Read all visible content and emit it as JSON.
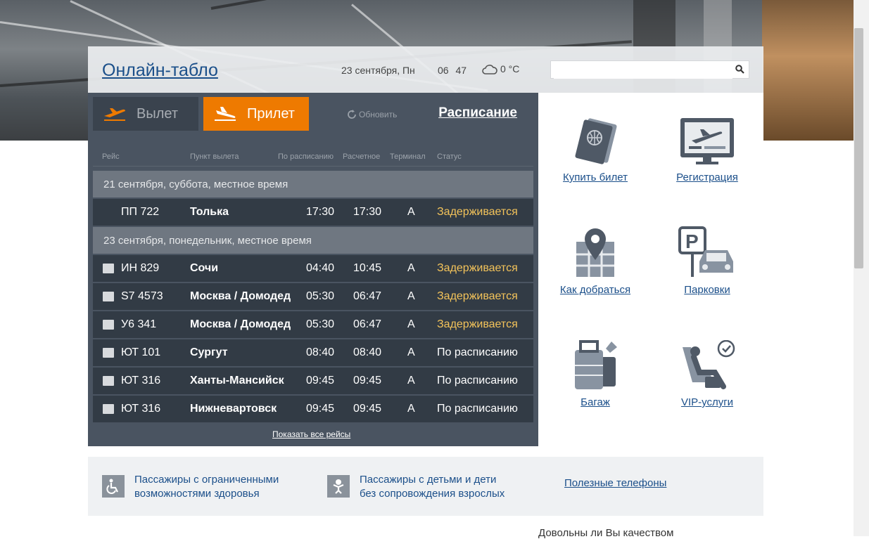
{
  "header": {
    "title": "Онлайн-табло",
    "date": "23 сентября, Пн",
    "time": "06 47",
    "temperature": "0 °C",
    "search_placeholder": ""
  },
  "board": {
    "tabs": {
      "departure": "Вылет",
      "arrival": "Прилет"
    },
    "refresh_label": "Обновить",
    "schedule_link": "Расписание",
    "columns": [
      "Рейс",
      "Пункт вылета",
      "По расписанию",
      "Расчетное",
      "Терминал",
      "Статус"
    ],
    "groups": [
      {
        "date": "21 сентября, суббота, местное время",
        "flights": [
          {
            "flight": "ПП 722",
            "city": "Толька",
            "scheduled": "17:30",
            "estimated": "17:30",
            "terminal": "A",
            "status": "Задерживается",
            "status_type": "delay",
            "logo": ""
          }
        ]
      },
      {
        "date": "23 сентября, понедельник, местное время",
        "flights": [
          {
            "flight": "ИН 829",
            "city": "Сочи",
            "scheduled": "04:40",
            "estimated": "10:45",
            "terminal": "A",
            "status": "Задерживается",
            "status_type": "delay",
            "logo": "nordwind"
          },
          {
            "flight": "S7 4573",
            "city": "Москва / Домодед",
            "scheduled": "05:30",
            "estimated": "06:47",
            "terminal": "A",
            "status": "Задерживается",
            "status_type": "delay",
            "logo": "s7"
          },
          {
            "flight": "У6 341",
            "city": "Москва / Домодед",
            "scheduled": "05:30",
            "estimated": "06:47",
            "terminal": "A",
            "status": "Задерживается",
            "status_type": "delay",
            "logo": "ural"
          },
          {
            "flight": "ЮТ 101",
            "city": "Сургут",
            "scheduled": "08:40",
            "estimated": "08:40",
            "terminal": "A",
            "status": "По расписанию",
            "status_type": "ok",
            "logo": "utair"
          },
          {
            "flight": "ЮТ 316",
            "city": "Ханты-Мансийск",
            "scheduled": "09:45",
            "estimated": "09:45",
            "terminal": "A",
            "status": "По расписанию",
            "status_type": "ok",
            "logo": "utair"
          },
          {
            "flight": "ЮТ 316",
            "city": "Нижневартовск",
            "scheduled": "09:45",
            "estimated": "09:45",
            "terminal": "A",
            "status": "По расписанию",
            "status_type": "ok",
            "logo": "utair"
          }
        ]
      }
    ],
    "show_all": "Показать все рейсы"
  },
  "services": [
    {
      "label": "Купить билет",
      "icon": "passport-icon"
    },
    {
      "label": "Регистрация",
      "icon": "checkin-monitor-icon"
    },
    {
      "label": "Как добраться",
      "icon": "map-pin-icon"
    },
    {
      "label": "Парковки",
      "icon": "parking-icon"
    },
    {
      "label": "Багаж",
      "icon": "baggage-icon"
    },
    {
      "label": "VIP-услуги",
      "icon": "vip-seat-icon"
    }
  ],
  "bottom": {
    "disabled_link": [
      "Пассажиры с ограниченными",
      "возможностями здоровья"
    ],
    "children_link": [
      "Пассажиры с детьми и дети",
      "без сопровождения взрослых"
    ],
    "phones": "Полезные телефоны",
    "survey": "Довольны ли Вы качеством"
  },
  "colors": {
    "accent": "#ee7a00",
    "delay": "#f3c35a",
    "link": "#1b4f8a",
    "board": "#4a5461",
    "row": "#323b45"
  }
}
